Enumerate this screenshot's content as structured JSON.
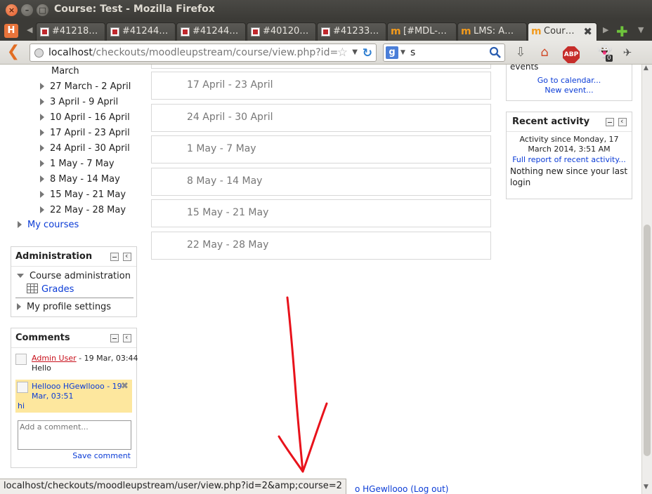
{
  "window": {
    "title": "Course: Test - Mozilla Firefox"
  },
  "tabs": [
    {
      "label": "#41218…",
      "icon": "tracker-icon"
    },
    {
      "label": "#41244…",
      "icon": "tracker-icon"
    },
    {
      "label": "#41244…",
      "icon": "tracker-icon"
    },
    {
      "label": "#40120…",
      "icon": "tracker-icon"
    },
    {
      "label": "#41233…",
      "icon": "tracker-icon"
    },
    {
      "label": "[#MDL-…",
      "icon": "moodle-icon"
    },
    {
      "label": "LMS: A…",
      "icon": "moodle-icon"
    },
    {
      "label": "Cour…",
      "icon": "moodle-icon",
      "active": true
    }
  ],
  "nav": {
    "url_host": "localhost",
    "url_path": "/checkouts/moodleupstream/course/view.php?id=",
    "search_value": "s"
  },
  "left_nav": {
    "partial_item": "March",
    "weeks": [
      "27 March - 2 April",
      "3 April - 9 April",
      "10 April - 16 April",
      "17 April - 23 April",
      "24 April - 30 April",
      "1 May - 7 May",
      "8 May - 14 May",
      "15 May - 21 May",
      "22 May - 28 May"
    ],
    "my_courses": "My courses"
  },
  "administration": {
    "title": "Administration",
    "course_admin": "Course administration",
    "grades": "Grades",
    "profile_settings": "My profile settings"
  },
  "comments": {
    "title": "Comments",
    "items": [
      {
        "author": "Admin User",
        "time": " - 19 Mar, 03:44",
        "text": "Hello"
      },
      {
        "author": "Hellooo HGewllooo",
        "time": " - 19 Mar, 03:51",
        "text": "hi"
      }
    ],
    "placeholder": "Add a comment...",
    "save": "Save comment"
  },
  "sections": [
    "17 April - 23 April",
    "24 April - 30 April",
    "1 May - 7 May",
    "8 May - 14 May",
    "15 May - 21 May",
    "22 May - 28 May"
  ],
  "calendar": {
    "partial": "events",
    "go_to_calendar": "Go to calendar...",
    "new_event": "New event..."
  },
  "recent_activity": {
    "title": "Recent activity",
    "since": "Activity since Monday, 17 March 2014, 3:51 AM",
    "full_report": "Full report of recent activity...",
    "nothing_new": "Nothing new since your last login"
  },
  "footer": {
    "logged_in_partial": "o HGewllooo",
    "logout": "(Log out)"
  },
  "status_url": "localhost/checkouts/moodleupstream/user/view.php?id=2&amp;course=2",
  "colors": {
    "link": "#0a3bd6",
    "annotation_arrow": "#e8121b",
    "comment_highlight": "#fde79e"
  }
}
